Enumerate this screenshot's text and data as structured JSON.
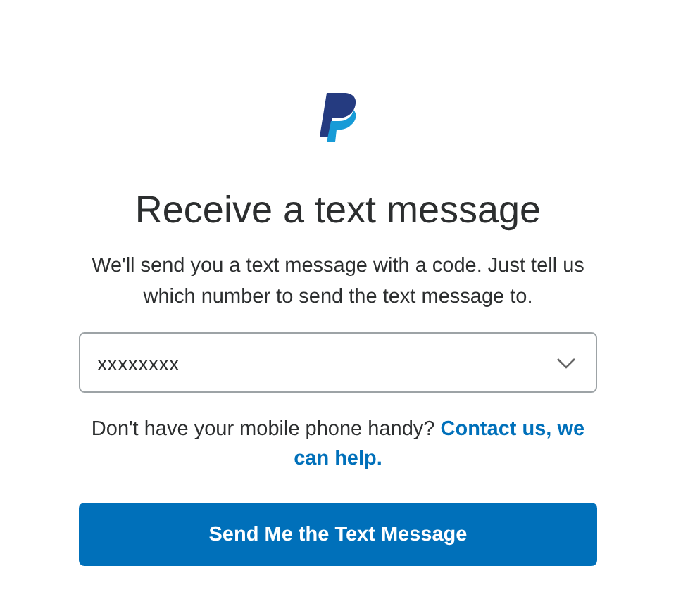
{
  "title": "Receive a text message",
  "description": "We'll send you a text message with a code. Just tell us which number to send the text message to.",
  "phone_select": {
    "value": "xxxxxxxx"
  },
  "help": {
    "text": "Don't have your mobile phone handy?",
    "link_lines": [
      "Contact us, we",
      "can help."
    ]
  },
  "submit_button": "Send Me the Text Message"
}
